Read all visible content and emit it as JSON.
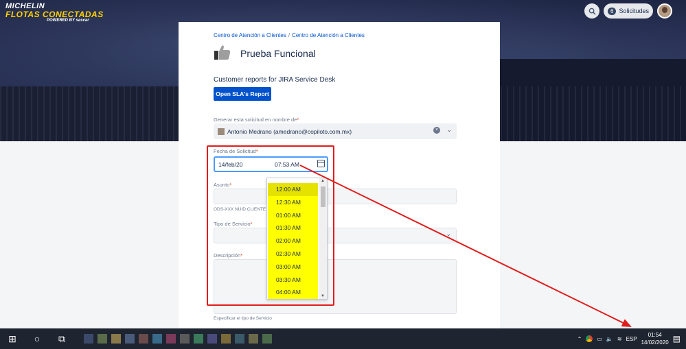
{
  "header": {
    "logo_line1": "MICHELIN",
    "logo_line2": "FLOTAS CONECTADAS",
    "logo_line3": "POWERED BY sascar",
    "search_icon": "search-icon",
    "requests_count": "6",
    "requests_label": "Solicitudes",
    "avatar": "user-avatar"
  },
  "breadcrumb": [
    "Centro de Atención a Clientes",
    "Centro de Atención a Clientes"
  ],
  "page_title": "Prueba Funcional",
  "reports": {
    "heading": "Customer reports for JIRA Service Desk",
    "button": "Open SLA's Report"
  },
  "form": {
    "on_behalf_label": "Generar esta solicitud en nombre de",
    "on_behalf_value": "Antonio Medrano (amedrano@copiloto.com.mx)",
    "date_label": "Fecha de Solicitud",
    "date_value": "14/feb/20",
    "time_value": "07:53 AM",
    "subject_label": "Asunto",
    "subject_helper": "ODS-XXX NUID CLIENTE",
    "service_type_label": "Tipo de Servicio",
    "description_label": "Descripción",
    "description_helper": "Especificar el tipo de Servicio",
    "required_mark": "*"
  },
  "time_options": [
    "12:00 AM",
    "12:30 AM",
    "01:00 AM",
    "01:30 AM",
    "02:00 AM",
    "02:30 AM",
    "03:00 AM",
    "03:30 AM",
    "04:00 AM"
  ],
  "taskbar": {
    "language": "ESP",
    "time": "01:54",
    "date": "14/02/2020"
  },
  "colors": {
    "primary": "#0052cc",
    "highlight": "#ffff00",
    "annotation": "#e01c1c",
    "header_bg": "#1b2240"
  }
}
